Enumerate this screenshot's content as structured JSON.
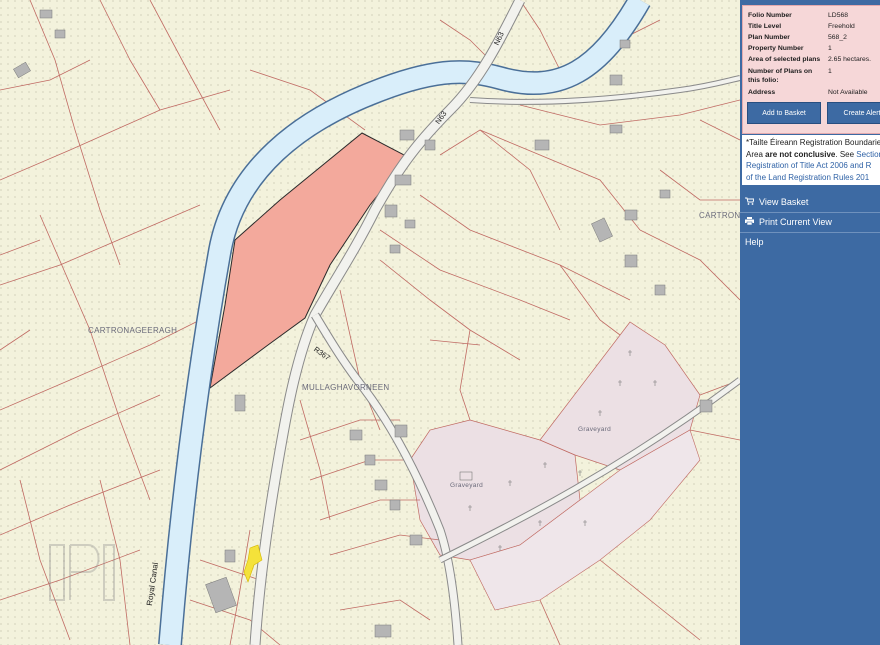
{
  "map": {
    "place_labels": {
      "cartronageeragh": "CARTRONAGEERAGH",
      "mullaghavorneen": "MULLAGHAVORNEEN",
      "cartrona": "CARTRONA"
    },
    "road_labels": {
      "n63": "N63",
      "r367": "R367",
      "royal_canal": "Royal Canal"
    },
    "feature_labels": {
      "graveyard_1": "Graveyard",
      "graveyard_2": "Graveyard"
    },
    "watermark": "PPI",
    "colors": {
      "background": "#f3f2dc",
      "boundary": "#c06a63",
      "canal_fill": "#d9eefa",
      "canal_edge": "#4a6f98",
      "selected_plot": "#f3a99c",
      "graveyard": "#ece0e4",
      "building": "#b5b5b5",
      "road": "#f2f2ee"
    }
  },
  "info": {
    "folio_number_label": "Folio Number",
    "folio_number_value": "LD568",
    "title_level_label": "Title Level",
    "title_level_value": "Freehold",
    "plan_number_label": "Plan Number",
    "plan_number_value": "568_2",
    "property_number_label": "Property Number",
    "property_number_value": "1",
    "area_label": "Area of selected plans",
    "area_value": "2.65 hectares.",
    "num_plans_label_1": "Number of Plans on",
    "num_plans_label_2": "this folio:",
    "num_plans_value": "1",
    "address_label": "Address",
    "address_value": "Not Available",
    "add_to_basket": "Add to Basket",
    "create_alert": "Create Alert"
  },
  "notice": {
    "line1": "*Tailte Éireann Registration Boundaries",
    "line2a": "Area ",
    "line2b": "are not conclusive",
    "line2c": ". See ",
    "line2d": "Section",
    "line3": "Registration of Title Act 2006 and R",
    "line4": "of the Land Registration Rules 201"
  },
  "sidebar": {
    "view_basket": "View Basket",
    "print_current_view": "Print Current View",
    "help": "Help",
    "basket_icon": "shopping-cart-icon",
    "print_icon": "printer-icon"
  }
}
